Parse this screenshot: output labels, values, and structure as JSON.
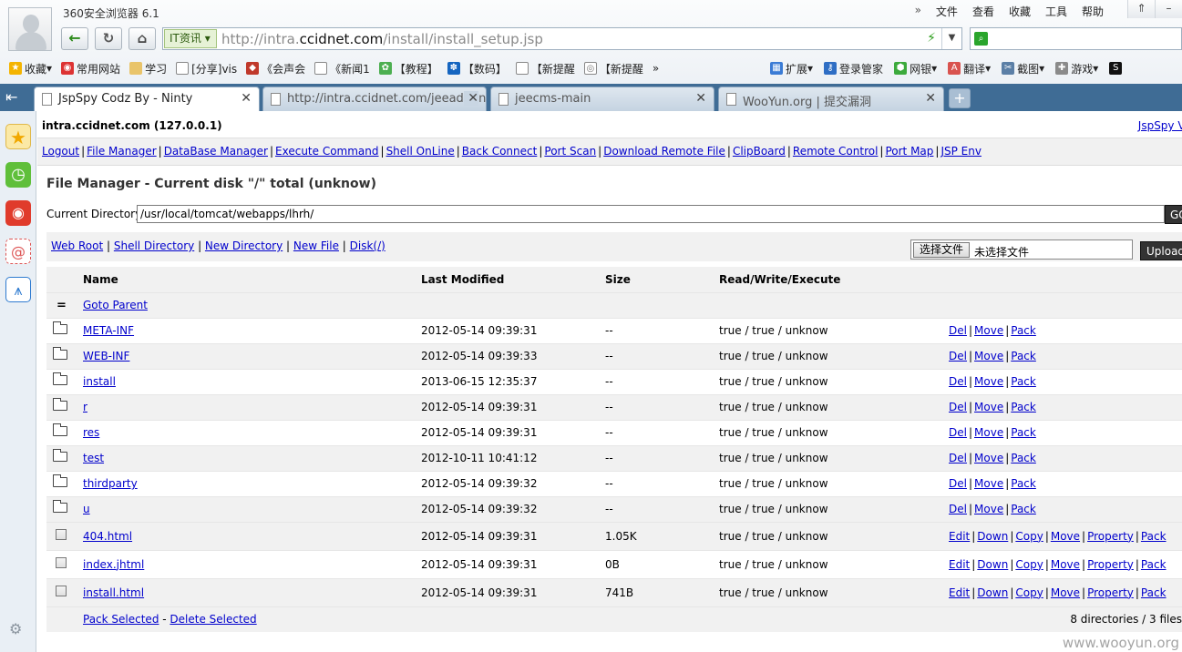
{
  "browser": {
    "title": "360安全浏览器 6.1",
    "menu": [
      "»",
      "文件",
      "查看",
      "收藏",
      "工具",
      "帮助"
    ],
    "window_buttons": [
      "⇑",
      "–"
    ],
    "address": {
      "tag": "IT资讯",
      "url_pre": "http://intra.",
      "url_host": "ccidnet.com",
      "url_post": "/install/install_setup.jsp"
    },
    "favorites": [
      "收藏",
      "常用网站",
      "学习",
      "[分享]vis",
      "《会声会",
      "《新闻1",
      "【教程】",
      "【数码】",
      "【新提醒",
      "【新提醒",
      "»"
    ],
    "extensions": [
      "扩展",
      "登录管家",
      "网银",
      "翻译",
      "截图",
      "游戏"
    ],
    "tabs": [
      {
        "label": "JspSpy Codz By - Ninty",
        "active": true
      },
      {
        "label": "http://intra.ccidnet.com/jeeadmin/",
        "active": false
      },
      {
        "label": "jeecms-main",
        "active": false
      },
      {
        "label": "WooYun.org | 提交漏洞",
        "active": false
      }
    ]
  },
  "page": {
    "host": "intra.ccidnet.com (127.0.0.1)",
    "version_link": "JspSpy Ve",
    "nav": [
      "Logout",
      "File Manager",
      "DataBase Manager",
      "Execute Command",
      "Shell OnLine",
      "Back Connect",
      "Port Scan",
      "Download Remote File",
      "ClipBoard",
      "Remote Control",
      "Port Map",
      "JSP Env"
    ],
    "fm_title": "File Manager - Current disk \"/\" total (unknow)",
    "current_dir_label": "Current Directory",
    "current_dir": "/usr/local/tomcat/webapps/lhrh/",
    "go_label": "GO",
    "sub_links": [
      "Web Root",
      "Shell Directory",
      "New Directory",
      "New File",
      "Disk(/)"
    ],
    "choose_file": "选择文件",
    "no_file": "未选择文件",
    "upload_label": "Upload",
    "columns": [
      "Name",
      "Last Modified",
      "Size",
      "Read/Write/Execute"
    ],
    "goto_parent": "Goto Parent",
    "dirs": [
      {
        "name": "META-INF",
        "modified": "2012-05-14 09:39:31",
        "size": "--",
        "rwx": "true / true / unknow"
      },
      {
        "name": "WEB-INF",
        "modified": "2012-05-14 09:39:33",
        "size": "--",
        "rwx": "true / true / unknow"
      },
      {
        "name": "install",
        "modified": "2013-06-15 12:35:37",
        "size": "--",
        "rwx": "true / true / unknow"
      },
      {
        "name": "r",
        "modified": "2012-05-14 09:39:31",
        "size": "--",
        "rwx": "true / true / unknow"
      },
      {
        "name": "res",
        "modified": "2012-05-14 09:39:31",
        "size": "--",
        "rwx": "true / true / unknow"
      },
      {
        "name": "test",
        "modified": "2012-10-11 10:41:12",
        "size": "--",
        "rwx": "true / true / unknow"
      },
      {
        "name": "thirdparty",
        "modified": "2012-05-14 09:39:32",
        "size": "--",
        "rwx": "true / true / unknow"
      },
      {
        "name": "u",
        "modified": "2012-05-14 09:39:32",
        "size": "--",
        "rwx": "true / true / unknow"
      }
    ],
    "dir_actions": [
      "Del",
      "Move",
      "Pack"
    ],
    "files": [
      {
        "name": "404.html",
        "modified": "2012-05-14 09:39:31",
        "size": "1.05K",
        "rwx": "true / true / unknow"
      },
      {
        "name": "index.jhtml",
        "modified": "2012-05-14 09:39:31",
        "size": "0B",
        "rwx": "true / true / unknow"
      },
      {
        "name": "install.html",
        "modified": "2012-05-14 09:39:31",
        "size": "741B",
        "rwx": "true / true / unknow"
      }
    ],
    "file_actions": [
      "Edit",
      "Down",
      "Copy",
      "Move",
      "Property",
      "Pack"
    ],
    "pack_selected": "Pack Selected",
    "footer_sep": " - ",
    "delete_selected": "Delete Selected",
    "summary": "8 directories / 3 files"
  },
  "watermark": "www.wooyun.org",
  "colors": {
    "link": "#0000cc",
    "tab_strip": "#3f6c95",
    "row_alt": "#f1f1f1"
  }
}
